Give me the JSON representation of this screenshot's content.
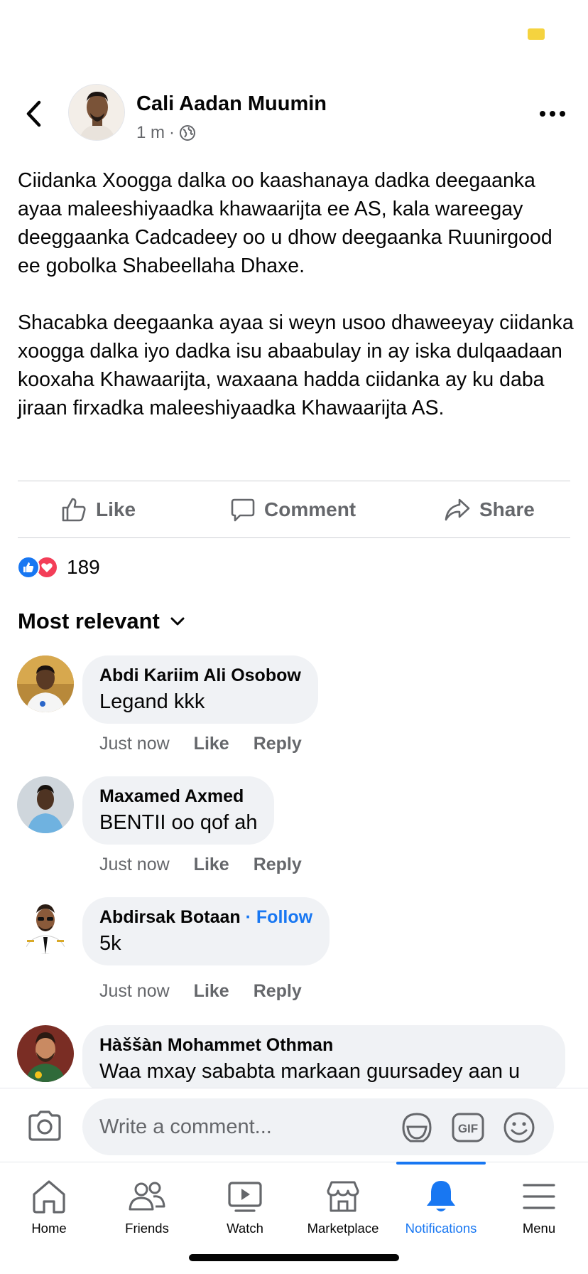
{
  "colors": {
    "accent": "#1877f2",
    "secondary_text": "#65676b",
    "bubble": "#f0f2f5",
    "love": "#f33e58"
  },
  "post": {
    "author": "Cali Aadan Muumin",
    "time": "1 m",
    "separator": "·",
    "audience_icon": "globe-icon",
    "paragraphs": [
      "Ciidanka Xoogga dalka oo kaashanaya dadka deegaanka ayaa maleeshiyaadka khawaarijta ee AS, kala wareegay deeggaanka Cadcadeey oo u dhow deegaanka Ruunirgood ee gobolka Shabeellaha Dhaxe.",
      "Shacabka deegaanka ayaa si weyn usoo dhaweeyay ciidanka xoogga dalka iyo dadka isu abaabulay in ay iska dulqaadaan kooxaha Khawaarijta, waxaana hadda ciidanka ay ku daba jiraan firxadka maleeshiyaadka Khawaarijta AS."
    ]
  },
  "actions": {
    "like": "Like",
    "comment": "Comment",
    "share": "Share"
  },
  "reactions": {
    "count": "189",
    "types": [
      "like",
      "love"
    ]
  },
  "sort": {
    "label": "Most relevant"
  },
  "comments": [
    {
      "name": "Abdi Kariim Ali Osobow",
      "text": "Legand kkk",
      "time": "Just now",
      "like": "Like",
      "reply": "Reply"
    },
    {
      "name": "Maxamed Axmed",
      "text": "BENTII oo qof ah",
      "time": "Just now",
      "like": "Like",
      "reply": "Reply"
    },
    {
      "name": "Abdirsak Botaan",
      "follow_sep": "·",
      "follow": "Follow",
      "text": "5k",
      "time": "Just now",
      "like": "Like",
      "reply": "Reply"
    },
    {
      "name": "Hàššàn Mohammet Othman",
      "text": "Waa mxay sababta markaan guursadey aan u"
    }
  ],
  "composer": {
    "placeholder": "Write a comment...",
    "gif": "GIF"
  },
  "tabs": [
    {
      "label": "Home",
      "icon": "home-icon"
    },
    {
      "label": "Friends",
      "icon": "friends-icon"
    },
    {
      "label": "Watch",
      "icon": "watch-icon"
    },
    {
      "label": "Marketplace",
      "icon": "marketplace-icon"
    },
    {
      "label": "Notifications",
      "icon": "bell-icon",
      "active": true
    },
    {
      "label": "Menu",
      "icon": "menu-icon"
    }
  ]
}
